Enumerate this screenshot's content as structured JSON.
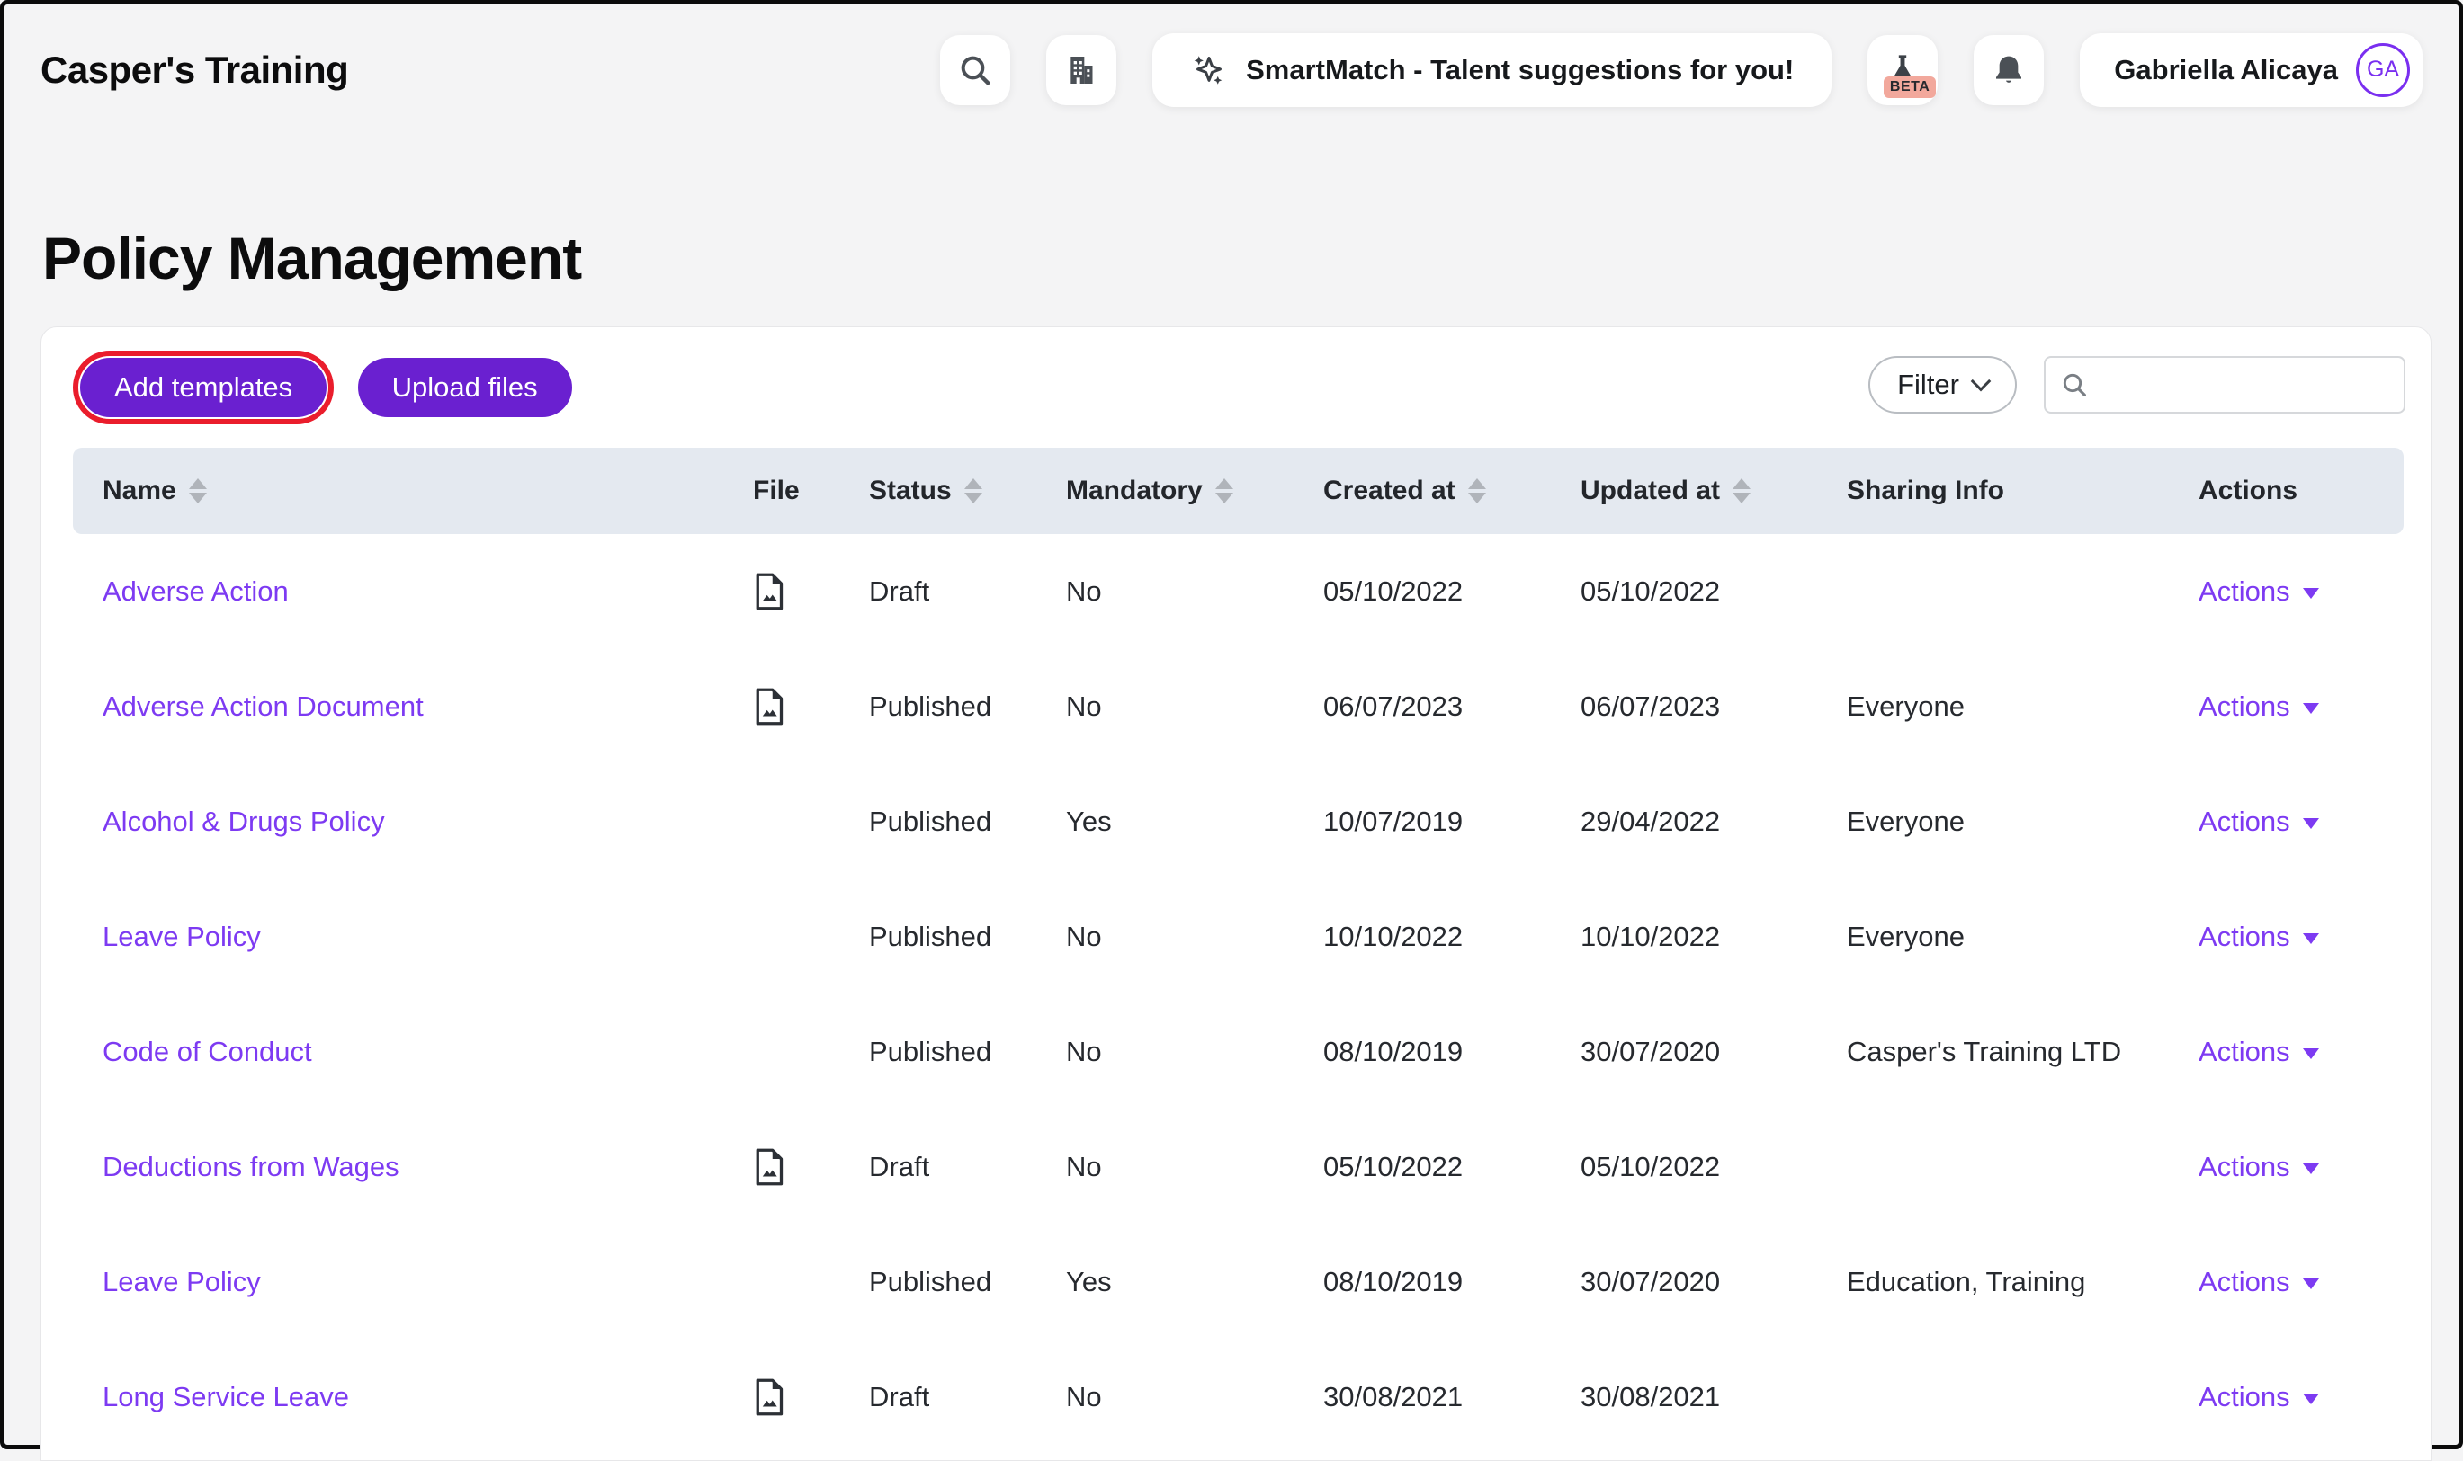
{
  "topbar": {
    "logo": "Casper's Training",
    "smartmatch_label": "SmartMatch - Talent suggestions for you!",
    "beta_label": "BETA",
    "user_name": "Gabriella Alicaya",
    "user_initials": "GA"
  },
  "page": {
    "title": "Policy Management"
  },
  "toolbar": {
    "add_templates_label": "Add templates",
    "upload_files_label": "Upload files",
    "filter_label": "Filter",
    "search_value": ""
  },
  "table": {
    "columns": [
      {
        "key": "name",
        "label": "Name",
        "sortable": true
      },
      {
        "key": "file",
        "label": "File",
        "sortable": false
      },
      {
        "key": "status",
        "label": "Status",
        "sortable": true
      },
      {
        "key": "mandatory",
        "label": "Mandatory",
        "sortable": true
      },
      {
        "key": "created-at",
        "label": "Created at",
        "sortable": true
      },
      {
        "key": "updated-at",
        "label": "Updated at",
        "sortable": true
      },
      {
        "key": "sharing-info",
        "label": "Sharing Info",
        "sortable": false
      },
      {
        "key": "actions",
        "label": "Actions",
        "sortable": false
      }
    ],
    "rows": [
      {
        "name": "Adverse Action",
        "has_file": true,
        "status": "Draft",
        "mandatory": "No",
        "created_at": "05/10/2022",
        "updated_at": "05/10/2022",
        "sharing_info": "",
        "actions_label": "Actions"
      },
      {
        "name": "Adverse Action Document",
        "has_file": true,
        "status": "Published",
        "mandatory": "No",
        "created_at": "06/07/2023",
        "updated_at": "06/07/2023",
        "sharing_info": "Everyone",
        "actions_label": "Actions"
      },
      {
        "name": "Alcohol & Drugs Policy",
        "has_file": false,
        "status": "Published",
        "mandatory": "Yes",
        "created_at": "10/07/2019",
        "updated_at": "29/04/2022",
        "sharing_info": "Everyone",
        "actions_label": "Actions"
      },
      {
        "name": "Leave Policy",
        "has_file": false,
        "status": "Published",
        "mandatory": "No",
        "created_at": "10/10/2022",
        "updated_at": "10/10/2022",
        "sharing_info": "Everyone",
        "actions_label": "Actions"
      },
      {
        "name": "Code of Conduct",
        "has_file": false,
        "status": "Published",
        "mandatory": "No",
        "created_at": "08/10/2019",
        "updated_at": "30/07/2020",
        "sharing_info": "Casper's Training LTD",
        "actions_label": "Actions"
      },
      {
        "name": "Deductions from Wages",
        "has_file": true,
        "status": "Draft",
        "mandatory": "No",
        "created_at": "05/10/2022",
        "updated_at": "05/10/2022",
        "sharing_info": "",
        "actions_label": "Actions"
      },
      {
        "name": "Leave Policy",
        "has_file": false,
        "status": "Published",
        "mandatory": "Yes",
        "created_at": "08/10/2019",
        "updated_at": "30/07/2020",
        "sharing_info": "Education, Training",
        "actions_label": "Actions"
      },
      {
        "name": "Long Service Leave",
        "has_file": true,
        "status": "Draft",
        "mandatory": "No",
        "created_at": "30/08/2021",
        "updated_at": "30/08/2021",
        "sharing_info": "",
        "actions_label": "Actions"
      }
    ]
  },
  "colors": {
    "button_purple": "#6a20d0",
    "link_purple": "#7d3af2",
    "annotation_red": "#ea1d2c",
    "table_header_bg": "#e4e9f0",
    "beta_badge_bg": "#f2a89c",
    "page_bg": "#f4f4f5"
  }
}
